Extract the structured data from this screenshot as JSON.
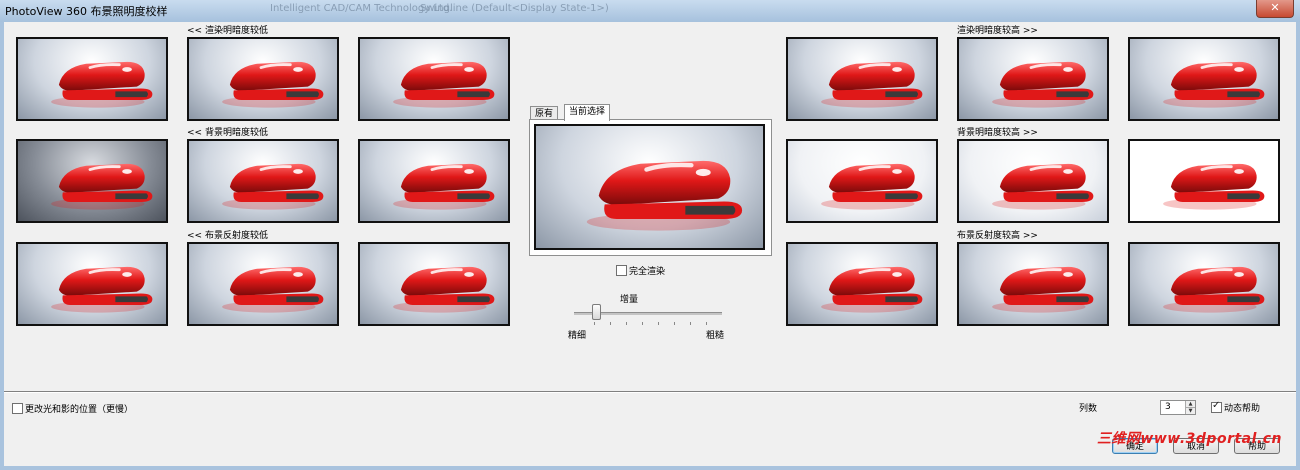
{
  "window": {
    "title": "PhotoView 360 布景照明度校样",
    "ghost_left": "Intelligent CAD/CAM Technology Ltd.",
    "ghost_right": "Swingline (Default<Display State-1>)",
    "close_glyph": "✕"
  },
  "groups": {
    "render_low": "<< 渲染明暗度较低",
    "render_high": "渲染明暗度较高 >>",
    "bg_low": "<< 背景明暗度较低",
    "bg_high": "背景明暗度较高 >>",
    "refl_low": "<< 布景反射度较低",
    "refl_high": "布景反射度较高 >>"
  },
  "center": {
    "tabs": [
      "原有",
      "当前选择"
    ],
    "active_tab": 1,
    "full_render_label": "完全渲染",
    "full_render_checked": false,
    "slider_title": "增量",
    "slider_min_label": "精细",
    "slider_max_label": "粗糙",
    "slider_value": 0.15
  },
  "footer": {
    "move_lights_label": "更改光和影的位置（更慢）",
    "move_lights_checked": false,
    "columns_label": "列数",
    "columns_value": "3",
    "dynamic_help_label": "动态帮助",
    "dynamic_help_checked": true,
    "ok_label": "确定",
    "cancel_label": "取消",
    "help_label": "帮助"
  },
  "watermark": "三维网www.3dportal.cn",
  "colors": {
    "accent_red": "#e01818",
    "titlebar": "#a6c1dd"
  },
  "icons": {
    "stapler": "stapler-render-icon"
  }
}
